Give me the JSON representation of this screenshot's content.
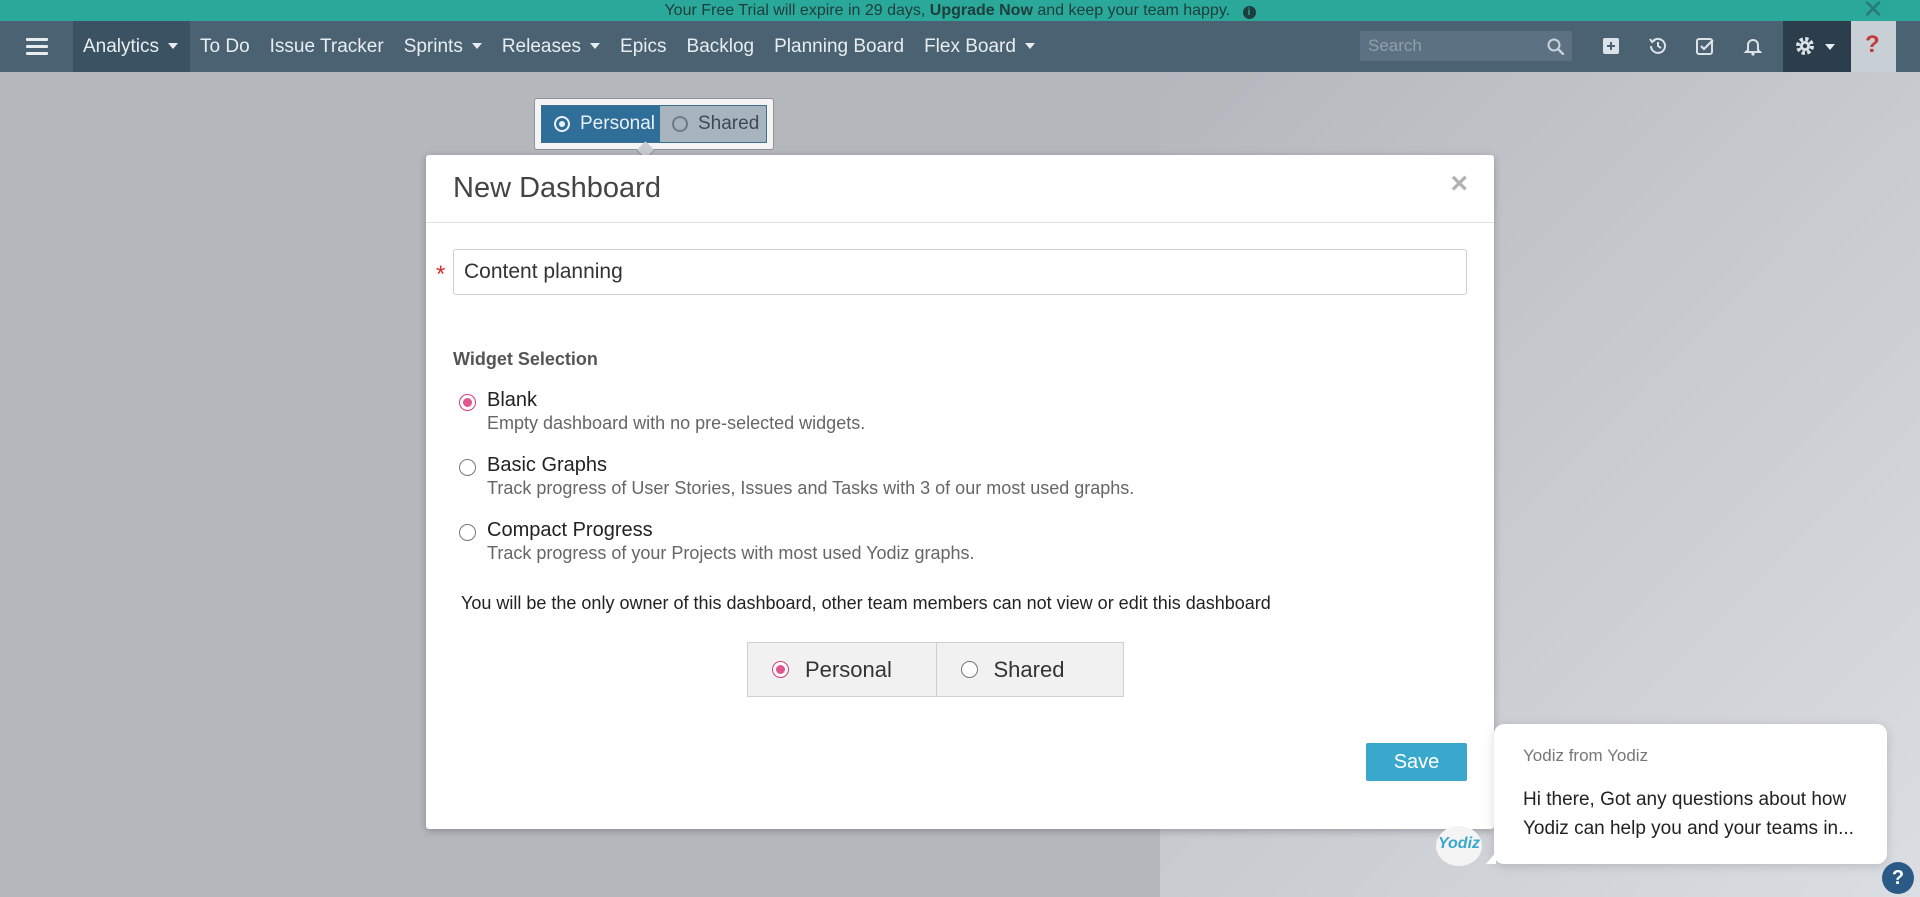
{
  "banner": {
    "prefix": "Your Free Trial will expire in 29 days,",
    "upgrade_link": "Upgrade Now",
    "suffix": "and keep your team happy.",
    "info_glyph": "i",
    "close_glyph": "✕"
  },
  "navbar": {
    "items": [
      {
        "label": "Analytics",
        "has_caret": true,
        "active": true
      },
      {
        "label": "To Do"
      },
      {
        "label": "Issue Tracker"
      },
      {
        "label": "Sprints",
        "has_caret": true
      },
      {
        "label": "Releases",
        "has_caret": true
      },
      {
        "label": "Epics"
      },
      {
        "label": "Backlog"
      },
      {
        "label": "Planning Board"
      },
      {
        "label": "Flex Board",
        "has_caret": true
      }
    ],
    "search_placeholder": "Search",
    "help_glyph": "?",
    "icons": [
      "add-icon",
      "history-icon",
      "tasks-icon",
      "bell-icon",
      "gear-icon",
      "help-icon"
    ]
  },
  "visibility_popover": {
    "options": [
      "Personal",
      "Shared"
    ],
    "selected": "Personal"
  },
  "modal": {
    "title": "New Dashboard",
    "close_glyph": "×",
    "required_mark": "*",
    "name_value": "Content planning",
    "widget_heading": "Widget Selection",
    "widget_options": [
      {
        "label": "Blank",
        "desc": "Empty dashboard with no pre-selected widgets.",
        "checked": true
      },
      {
        "label": "Basic Graphs",
        "desc": "Track progress of User Stories, Issues and Tasks with 3 of our most used graphs.",
        "checked": false
      },
      {
        "label": "Compact Progress",
        "desc": "Track progress of your Projects with most used Yodiz graphs.",
        "checked": false
      }
    ],
    "owner_note": "You will be the only owner of this dashboard, other team members can not view or edit this dashboard",
    "share_options": [
      "Personal",
      "Shared"
    ],
    "share_selected": "Personal",
    "save_label": "Save"
  },
  "chat": {
    "from": "Yodiz from Yodiz",
    "message": "Hi there, Got any questions about how Yodiz can help you and your teams in...",
    "avatar_glyph": "Yodiz",
    "help_glyph": "?"
  },
  "colors": {
    "banner_bg": "#2aa99b",
    "navbar_bg": "#4a6272",
    "accent_radio": "#e0568f",
    "save_button": "#3aa8cc",
    "popover_selected": "#2f6e98"
  }
}
